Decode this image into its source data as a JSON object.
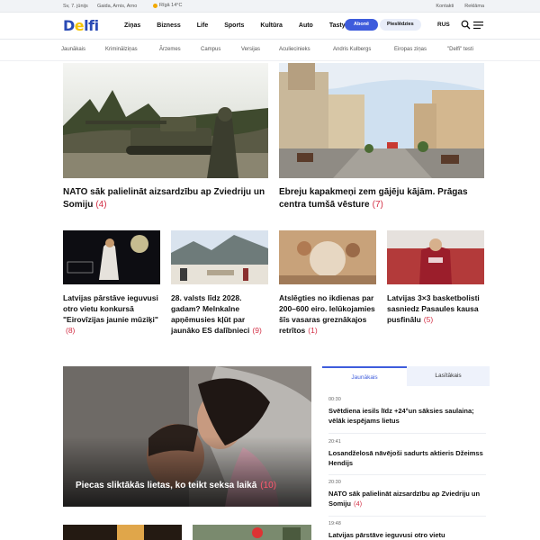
{
  "topbar": {
    "date": "Sv, 7. jūnijs",
    "names": "Gaida, Arnis, Arno",
    "weather": "Rīgā 14°C",
    "links": [
      "Kontakti",
      "Reklāma"
    ]
  },
  "header": {
    "logo_left": "D",
    "logo_e": "e",
    "logo_right": "lfi",
    "nav": [
      "Ziņas",
      "Bizness",
      "Life",
      "Sports",
      "Kultūra",
      "Auto",
      "Tasty"
    ],
    "subscribe_label": "Abonē",
    "login_label": "Pieslēdzies",
    "lang": "RUS"
  },
  "subnav": [
    "Jaunākais",
    "Kriminālziņas",
    "Ārzemes",
    "Campus",
    "Versijas",
    "Aculiecinieks",
    "Andris Kulbergs",
    "Eiropas ziņas",
    "\"Delfi\" testi"
  ],
  "top_stories": [
    {
      "text": "NATO sāk palielināt aizsardzību ap Zviedriju un Somiju",
      "count": "(4)"
    },
    {
      "text": "Ebreju kapakmeņi zem gājēju kājām. Prāgas centra tumšā vēsture",
      "count": "(7)"
    }
  ],
  "grid_stories": [
    {
      "text": "Latvijas pārstāve ieguvusi otro vietu konkursā \"Eirovīzijas jaunie mūziķi\"",
      "count": "(8)"
    },
    {
      "text": "28. valsts līdz 2028. gadam? Melnkalne apņēmusies kļūt par jaunāko ES dalībnieci",
      "count": "(9)"
    },
    {
      "text": "Atslēgties no ikdienas par 200–600 eiro. Ielūkojamies šīs vasaras greznākajos retrītos",
      "count": "(1)"
    },
    {
      "text": "Latvijas 3×3 basketbolisti sasniedz Pasaules kausa pusfinālu",
      "count": "(5)"
    }
  ],
  "feature": {
    "text": "Piecas sliktākās lietas, ko teikt seksa laikā",
    "count": "(10)"
  },
  "side_panel": {
    "tabs": [
      "Jaunākais",
      "Lasītākais"
    ],
    "items": [
      {
        "time": "00:30",
        "text": "Svētdiena iesils līdz +24°un sāksies saulaina; vēlāk iespējams lietus",
        "count": ""
      },
      {
        "time": "20:41",
        "text": "Losandželosā nāvējoši sadurts aktieris Džeimss Hendijs",
        "count": ""
      },
      {
        "time": "20:30",
        "text": "NATO sāk palielināt aizsardzību ap Zviedriju un Somiju",
        "count": "(4)"
      },
      {
        "time": "19:48",
        "text": "Latvijas pārstāve ieguvusi otro vietu",
        "count": ""
      }
    ]
  },
  "colors": {
    "brand": "#2a4bb5",
    "accent": "#3e5cdc",
    "count": "#d32f45"
  }
}
